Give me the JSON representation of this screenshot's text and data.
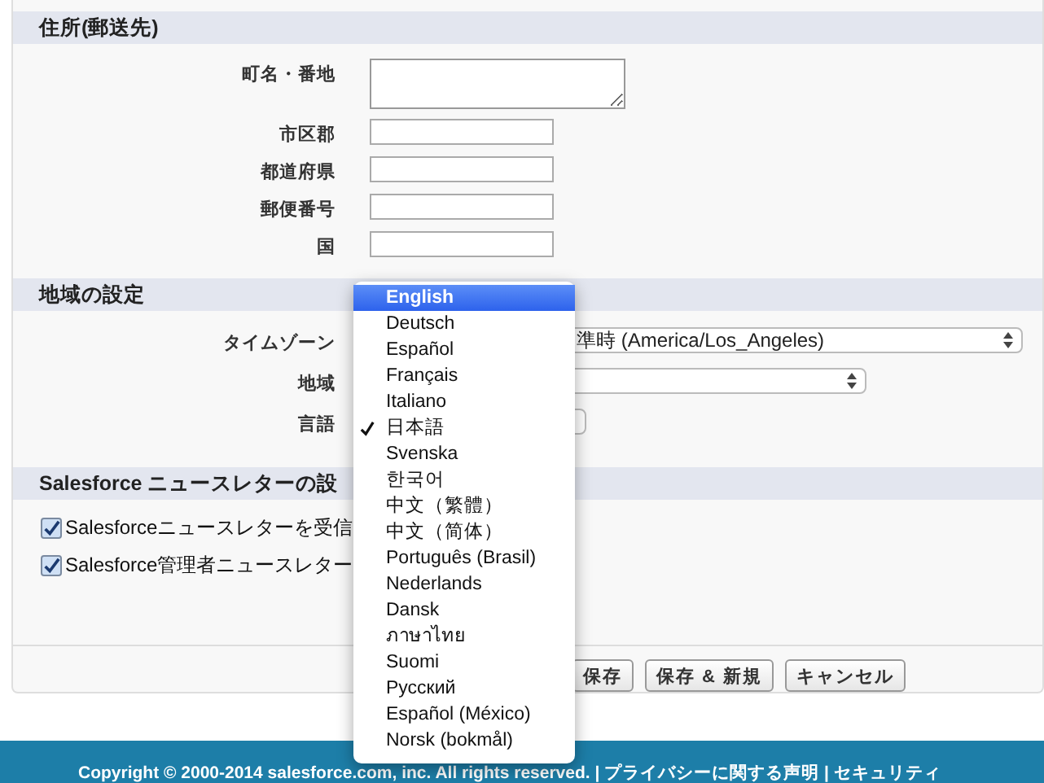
{
  "address_section": {
    "title": "住所(郵送先)",
    "fields": [
      {
        "label": "町名・番地",
        "kind": "textarea"
      },
      {
        "label": "市区郡",
        "kind": "text"
      },
      {
        "label": "都道府県",
        "kind": "text"
      },
      {
        "label": "郵便番号",
        "kind": "text"
      },
      {
        "label": "国",
        "kind": "text"
      }
    ]
  },
  "locale_section": {
    "title": "地域の設定",
    "fields": [
      {
        "label": "タイムゾーン",
        "value": "準時 (America/Los_Angeles)"
      },
      {
        "label": "地域"
      },
      {
        "label": "言語"
      }
    ]
  },
  "newsletter_section": {
    "title": "Salesforce ニュースレターの設",
    "options": [
      {
        "label": "Salesforceニュースレターを受信",
        "checked": true
      },
      {
        "label": "Salesforce管理者ニュースレター",
        "checked": true
      }
    ]
  },
  "buttons": [
    "保存",
    "保存 & 新規",
    "キャンセル"
  ],
  "language_menu": [
    {
      "label": "English",
      "selected": true,
      "checked": false
    },
    {
      "label": "Deutsch",
      "selected": false,
      "checked": false
    },
    {
      "label": "Español",
      "selected": false,
      "checked": false
    },
    {
      "label": "Français",
      "selected": false,
      "checked": false
    },
    {
      "label": "Italiano",
      "selected": false,
      "checked": false
    },
    {
      "label": "日本語",
      "selected": false,
      "checked": true
    },
    {
      "label": "Svenska",
      "selected": false,
      "checked": false
    },
    {
      "label": "한국어",
      "selected": false,
      "checked": false
    },
    {
      "label": "中文（繁體）",
      "selected": false,
      "checked": false
    },
    {
      "label": "中文（简体）",
      "selected": false,
      "checked": false
    },
    {
      "label": "Português (Brasil)",
      "selected": false,
      "checked": false
    },
    {
      "label": "Nederlands",
      "selected": false,
      "checked": false
    },
    {
      "label": "Dansk",
      "selected": false,
      "checked": false
    },
    {
      "label": "ภาษาไทย",
      "selected": false,
      "checked": false
    },
    {
      "label": "Suomi",
      "selected": false,
      "checked": false
    },
    {
      "label": "Русский",
      "selected": false,
      "checked": false
    },
    {
      "label": "Español (México)",
      "selected": false,
      "checked": false
    },
    {
      "label": "Norsk (bokmål)",
      "selected": false,
      "checked": false
    }
  ],
  "footer": {
    "text": "Copyright © 2000-2014 salesforce.com, inc. All rights reserved. | プライバシーに関する声明 | セキュリティ"
  }
}
